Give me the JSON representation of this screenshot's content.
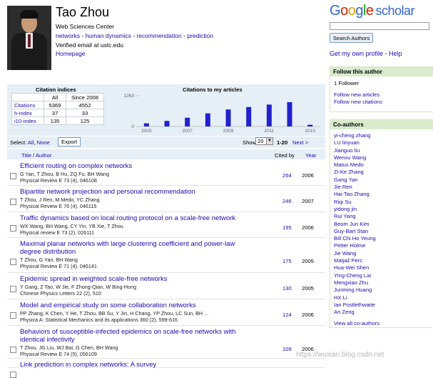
{
  "profile": {
    "name": "Tao Zhou",
    "affiliation": "Web Sciences Center",
    "keywords": [
      "networks",
      "human dynamics",
      "recommendation",
      "prediction"
    ],
    "email": "Verified email at ustc.edu",
    "homepage": "Homepage"
  },
  "logo": {
    "google": [
      "G",
      "o",
      "o",
      "g",
      "l",
      "e"
    ],
    "scholar": "scholar"
  },
  "search": {
    "placeholder": "",
    "button": "Search Authors"
  },
  "own_profile": {
    "link1": "Get my own profile",
    "sep": " - ",
    "link2": "Help"
  },
  "follow": {
    "heading": "Follow this author",
    "count": "1 Follower",
    "new_articles": "Follow new articles",
    "new_citations": "Follow new citations"
  },
  "coauthors": {
    "heading": "Co-authors",
    "names": [
      "yi-cheng zhang",
      "LU linyuan",
      "Jianguo liu",
      "Wenxu Wang",
      "Matus Medo",
      "Zi-Ke Zhang",
      "Gang Yan",
      "Jie Ren",
      "Hai-Tao Zhang",
      "Riqi Su",
      "yidong jin",
      "Rui Yang",
      "Beom Jun Kim",
      "Guy-Bart Stan",
      "Bill Chi Ho Yeung",
      "Petter Holme",
      "Jie Wang",
      "Matjaž Perc",
      "Hua-Wei Shen",
      "Ying-Cheng Lai",
      "Mengxiao Zhu",
      "Junming Huang",
      "HX Li",
      "Ian Postlethwaite",
      "An Zeng"
    ],
    "view_all": "View all co-authors"
  },
  "indices": {
    "title": "Citation indices",
    "col_all": "All",
    "col_since": "Since 2008",
    "rows": [
      {
        "label": "Citations",
        "all": "5369",
        "since": "4552"
      },
      {
        "label": "h-index",
        "all": "37",
        "since": "33"
      },
      {
        "label": "i10-index",
        "all": "135",
        "since": "125"
      }
    ]
  },
  "chart_data": {
    "type": "bar",
    "title": "Citations to my articles",
    "categories": [
      "2005",
      "2006",
      "2007",
      "2008",
      "2009",
      "2010",
      "2011",
      "2012",
      "2013"
    ],
    "values": [
      130,
      230,
      360,
      540,
      700,
      800,
      900,
      1000,
      70
    ],
    "xticks": [
      "2005",
      "2007",
      "2009",
      "2011",
      "2013"
    ],
    "yticks": [
      "1263",
      "0"
    ],
    "ylim": [
      0,
      1263
    ],
    "color": "#2222cc"
  },
  "toolbar": {
    "select_prefix": "Select: ",
    "select_all": "All",
    "select_sep": ", ",
    "select_none": "None",
    "export": "Export",
    "show_label": "Show",
    "show_value": "20",
    "range": "1-20",
    "next": "Next >"
  },
  "columns": {
    "title": "Title / Author",
    "cited": "Cited by",
    "year": "Year"
  },
  "articles": [
    {
      "title": "Efficient routing on complex networks",
      "authors": "G Yan, T Zhou, B Hu, ZQ Fu, BH Wang",
      "pub": "Physical Review E 73 (4), 046108",
      "cites": "264",
      "year": "2006"
    },
    {
      "title": "Bipartite network projection and personal recommendation",
      "authors": "T Zhou, J Ren, M Medo, YC Zhang",
      "pub": "Physical Review E 76 (4), 046115",
      "cites": "246",
      "year": "2007"
    },
    {
      "title": "Traffic dynamics based on local routing protocol on a scale-free network",
      "authors": "WX Wang, BH Wang, CY Yin, YB Xie, T Zhou",
      "pub": "Physical review E 73 (2), 026111",
      "cites": "195",
      "year": "2006"
    },
    {
      "title": "Maximal planar networks with large clustering coefficient and power-law degree distribution",
      "authors": "T Zhou, G Yan, BH Wang",
      "pub": "Physical Review E 71 (4), 046141",
      "cites": "175",
      "year": "2005"
    },
    {
      "title": "Epidemic spread in weighted scale-free networks",
      "authors": "Y Gang, Z Tao, W Jie, F Zhong-Qian, W Bing-Hong",
      "pub": "Chinese Physics Letters 22 (2), 510",
      "cites": "130",
      "year": "2005"
    },
    {
      "title": "Model and empirical study on some collaboration networks",
      "authors": "PP Zhang, K Chen, Y He, T Zhou, BB Su, Y Jin, H Chang, YP Zhou, LC Sun, BH ...",
      "pub": "Physica A: Statistical Mechanics and its applications 360 (2), 599-616",
      "cites": "124",
      "year": "2006"
    },
    {
      "title": "Behaviors of susceptible-infected epidemics on scale-free networks with identical infectivity",
      "authors": "T Zhou, JG Liu, WJ Bai, G Chen, BH Wang",
      "pub": "Physical Review E 74 (5), 056109",
      "cites": "109",
      "year": "2006"
    },
    {
      "title": "Link prediction in complex networks: A survey",
      "authors": "",
      "pub": "",
      "cites": "",
      "year": ""
    }
  ],
  "watermark": "https://wuxian.blog.csdn.net"
}
